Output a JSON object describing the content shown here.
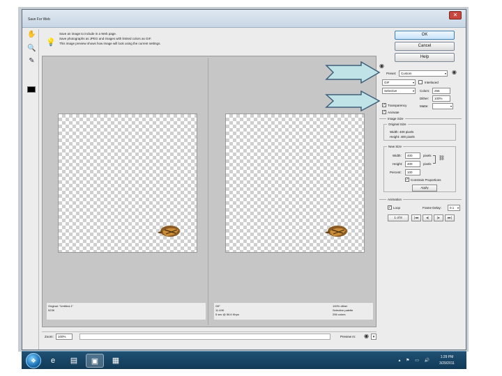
{
  "window": {
    "title": "Save For Web",
    "close_glyph": "✕"
  },
  "toolbar": {
    "icons": [
      "hand-icon",
      "zoom-icon",
      "eyedropper-icon",
      "eyedropper-color-icon"
    ]
  },
  "info": {
    "icon": "lightbulb-icon",
    "lines": [
      "Save an image to include in a Web page.",
      "Save photographs as JPEG and images with limited colors as GIF.",
      "This image preview shows how image will look using the current settings."
    ]
  },
  "preview": {
    "original_caption": [
      "Original: \"Untitled-1\"",
      "523K"
    ],
    "optimized_caption_left": [
      "GIF",
      "11.49K",
      "5 sec @ 56.6 Kbps"
    ],
    "optimized_caption_right": [
      "100% dither",
      "Selective palette",
      "256 colors"
    ]
  },
  "bottom": {
    "zoom_label": "Zoom:",
    "zoom_value": "100%",
    "browser_label": "Preview In:"
  },
  "buttons": {
    "ok": "OK",
    "cancel": "Cancel",
    "help": "Help"
  },
  "settings": {
    "preset_label": "Preset:",
    "preset_value": "Custom",
    "format_value": "GIF",
    "interlaced_label": "Interlaced",
    "palette_value": "Selective",
    "colors_label": "Colors:",
    "colors_value": "256",
    "dither_label": "Dither:",
    "dither_value": "100%",
    "transparency_label": "Transparency",
    "matte_label": "Matte:",
    "animate_label": "Animate",
    "check_glyph": "✓"
  },
  "image_size": {
    "tab_label": "Image Size",
    "original_group": "Original Size",
    "orig_width": "Width: 400 pixels",
    "orig_height": "Height: 400 pixels",
    "new_group": "New Size",
    "width_label": "Width:",
    "width_value": "400",
    "height_label": "Height:",
    "height_value": "400",
    "percent_label": "Percent:",
    "percent_value": "100",
    "pixels_unit": "pixels",
    "constrain_label": "Constrain Proportions",
    "apply_label": "Apply"
  },
  "animation": {
    "section_label": "Animation",
    "loop_label": "Loop",
    "frame_delay_label": "Frame Delay:",
    "frame_delay_value": "0.1",
    "frame_counter": "1 of 8"
  },
  "taskbar": {
    "time": "1:29 PM",
    "date": "3/29/2011"
  },
  "colors": {
    "arrow_fill": "#bfe3e6",
    "arrow_stroke": "#3f5f7a"
  }
}
